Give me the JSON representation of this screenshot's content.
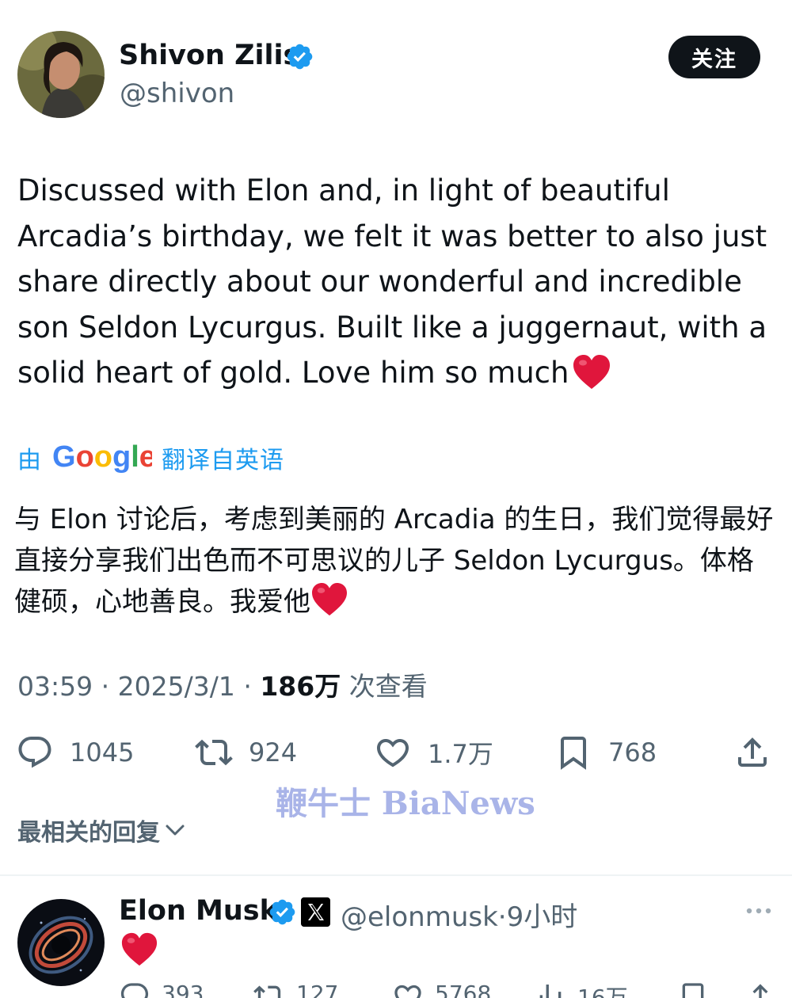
{
  "tweet": {
    "author_name": "Shivon Zilis",
    "author_handle": "@shivon",
    "follow_label": "关注",
    "text": "Discussed with Elon and, in light of beautiful Arcadia’s birthday, we felt it was better to also just share directly about our wonderful and incredible son Seldon Lycurgus. Built like a juggernaut, with a solid heart of gold. Love him so much",
    "text_emoji": "heart-emoji",
    "translation_by": "由",
    "translation_provider": "Google",
    "translation_label": "翻译自英语",
    "translated_text": "与 Elon 讨论后，考虑到美丽的 Arcadia 的生日，我们觉得最好直接分享我们出色而不可思议的儿子 Seldon Lycurgus。体格健硕，心地善良。我爱他",
    "time": "03:59",
    "date": "2025/3/1",
    "separator": "·",
    "views_count": "186万",
    "views_label": "次查看"
  },
  "actions": {
    "replies": "1045",
    "retweets": "924",
    "likes": "1.7万",
    "bookmarks": "768"
  },
  "watermark": "鞭牛士 BiaNews",
  "sort_label": "最相关的回复",
  "reply": {
    "author_name": "Elon Musk",
    "author_handle": "@elonmusk",
    "time_ago": "9小时",
    "separator": "·",
    "content_emoji": "heart-emoji",
    "actions": {
      "replies": "393",
      "retweets": "127",
      "likes": "5768",
      "views": "16万"
    }
  },
  "colors": {
    "text": "#0f1419",
    "secondary": "#536471",
    "accent": "#1d9bf0",
    "heart": "#e0163c",
    "watermark": "#a9b4e8"
  }
}
